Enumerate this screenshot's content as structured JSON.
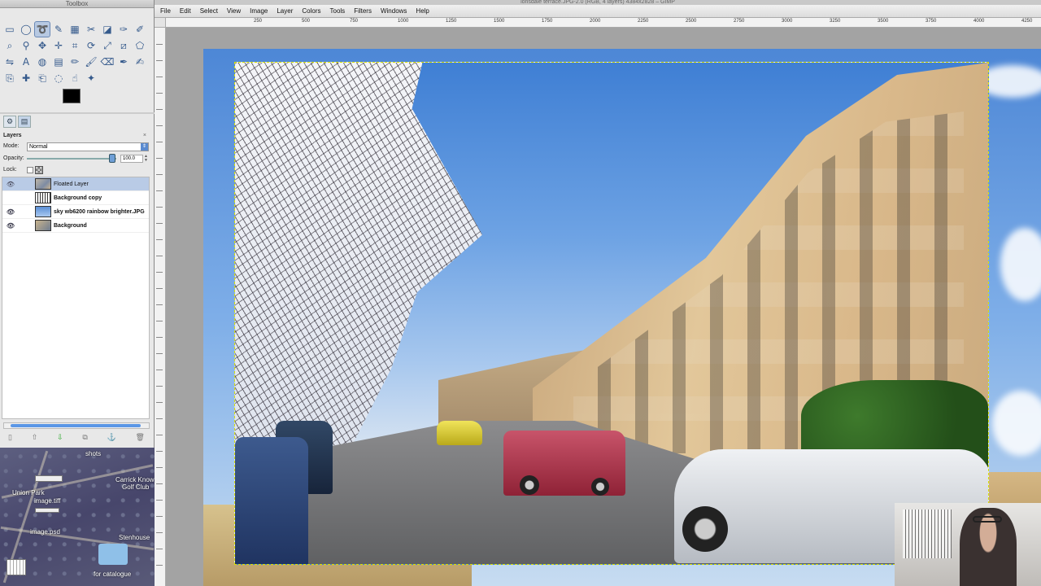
{
  "window": {
    "title": "lonsdale terrace.JPG-2.0 (RGB, 4 layers) 4384x2828 – GIMP",
    "toolbox_title": "Toolbox"
  },
  "menubar": [
    "File",
    "Edit",
    "Select",
    "View",
    "Image",
    "Layer",
    "Colors",
    "Tools",
    "Filters",
    "Windows",
    "Help"
  ],
  "ruler": {
    "labels": [
      "250",
      "500",
      "750",
      "1000",
      "1250",
      "1500",
      "1750",
      "2000",
      "2250",
      "2500",
      "2750",
      "3000",
      "3250",
      "3500",
      "3750",
      "4000",
      "4250"
    ]
  },
  "toolbox": {
    "tools": [
      {
        "name": "rect-select-tool-icon",
        "glyph": "▭"
      },
      {
        "name": "ellipse-select-tool-icon",
        "glyph": "◯"
      },
      {
        "name": "free-select-tool-icon",
        "glyph": "➰"
      },
      {
        "name": "fuzzy-select-tool-icon",
        "glyph": "✎"
      },
      {
        "name": "select-by-color-tool-icon",
        "glyph": "▦"
      },
      {
        "name": "scissors-tool-icon",
        "glyph": "✂"
      },
      {
        "name": "foreground-select-tool-icon",
        "glyph": "◪"
      },
      {
        "name": "paths-tool-icon",
        "glyph": "✑"
      },
      {
        "name": "color-picker-tool-icon",
        "glyph": "✐"
      },
      {
        "name": "zoom-tool-icon",
        "glyph": "⌕"
      },
      {
        "name": "measure-tool-icon",
        "glyph": "⚲"
      },
      {
        "name": "move-tool-icon",
        "glyph": "✥"
      },
      {
        "name": "align-tool-icon",
        "glyph": "✛"
      },
      {
        "name": "crop-tool-icon",
        "glyph": "⌗"
      },
      {
        "name": "rotate-tool-icon",
        "glyph": "⟳"
      },
      {
        "name": "scale-tool-icon",
        "glyph": "⤢"
      },
      {
        "name": "shear-tool-icon",
        "glyph": "⧄"
      },
      {
        "name": "perspective-tool-icon",
        "glyph": "⬠"
      },
      {
        "name": "flip-tool-icon",
        "glyph": "⇋"
      },
      {
        "name": "text-tool-icon",
        "glyph": "A"
      },
      {
        "name": "bucket-fill-tool-icon",
        "glyph": "◍"
      },
      {
        "name": "blend-tool-icon",
        "glyph": "▤"
      },
      {
        "name": "pencil-tool-icon",
        "glyph": "✏"
      },
      {
        "name": "paintbrush-tool-icon",
        "glyph": "🖌"
      },
      {
        "name": "eraser-tool-icon",
        "glyph": "⌫"
      },
      {
        "name": "airbrush-tool-icon",
        "glyph": "✒"
      },
      {
        "name": "ink-tool-icon",
        "glyph": "✍"
      },
      {
        "name": "clone-tool-icon",
        "glyph": "⎘"
      },
      {
        "name": "heal-tool-icon",
        "glyph": "✚"
      },
      {
        "name": "perspective-clone-tool-icon",
        "glyph": "⎗"
      },
      {
        "name": "blur-tool-icon",
        "glyph": "◌"
      },
      {
        "name": "smudge-tool-icon",
        "glyph": "☝"
      },
      {
        "name": "dodge-burn-tool-icon",
        "glyph": "✦"
      }
    ],
    "active_tool_index": 2,
    "fg_color": "#000000",
    "bg_color": "#ffffff"
  },
  "layers": {
    "title": "Layers",
    "mode_label": "Mode:",
    "mode_value": "Normal",
    "opacity_label": "Opacity:",
    "opacity_value": "100.0",
    "opacity_fraction": 1.0,
    "lock_label": "Lock:",
    "items": [
      {
        "name": "Floated Layer",
        "selected": true,
        "visible": true,
        "thumb": "t1"
      },
      {
        "name": "Background copy",
        "selected": false,
        "visible": false,
        "thumb": "t2"
      },
      {
        "name": "sky wb6200 rainbow brighter.JPG",
        "selected": false,
        "visible": true,
        "thumb": "t3"
      },
      {
        "name": "Background",
        "selected": false,
        "visible": true,
        "thumb": "t4"
      }
    ]
  },
  "desktop": {
    "labels": [
      {
        "text": "Union Park"
      },
      {
        "text": "image.tiff"
      },
      {
        "text": "image.psd"
      },
      {
        "text": "Carrick Know"
      },
      {
        "text": "Golf Club"
      },
      {
        "text": "Stenhouse"
      },
      {
        "text": "for catalogue"
      },
      {
        "text": "shots"
      }
    ]
  },
  "colors": {
    "selection_marquee": "#d8e000",
    "active_tool_bg": "#b7c9e2",
    "selected_layer_bg": "#b9cbe6"
  }
}
